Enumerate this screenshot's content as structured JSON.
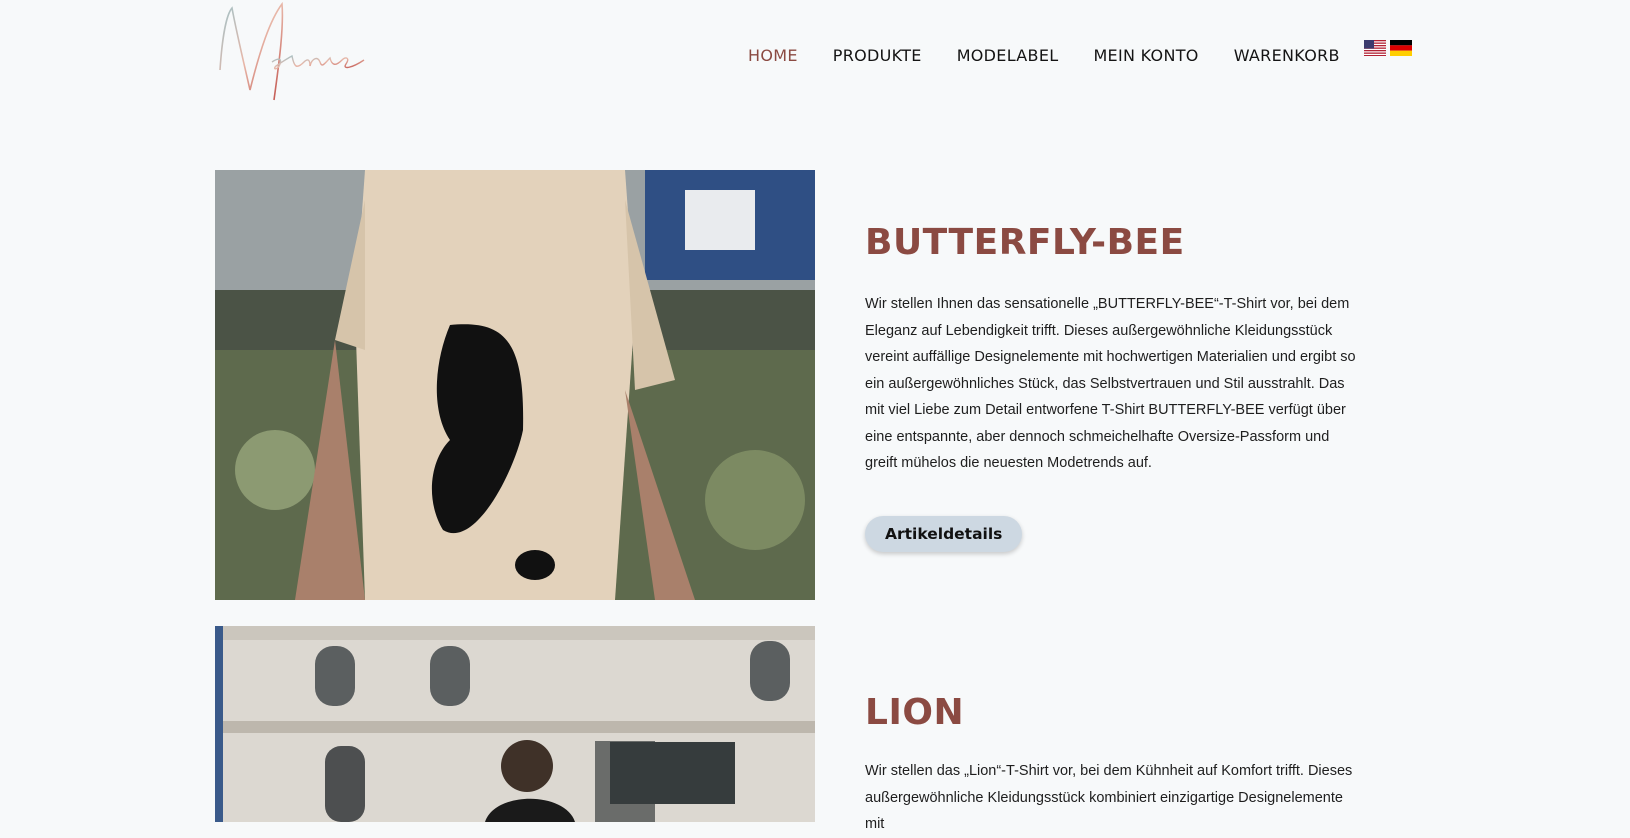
{
  "header": {
    "logo_text": "Nelane",
    "nav": [
      {
        "label": "HOME"
      },
      {
        "label": "PRODUKTE"
      },
      {
        "label": "MODELABEL"
      },
      {
        "label": "MEIN KONTO"
      },
      {
        "label": "WARENKORB"
      }
    ],
    "languages": [
      "flag-us-icon",
      "flag-de-icon"
    ]
  },
  "colors": {
    "accent": "#8b4a42",
    "button_bg": "#cdd8e2",
    "page_bg": "#f7f9fa"
  },
  "products": [
    {
      "title": "BUTTERFLY-BEE",
      "description": "Wir stellen Ihnen das sensationelle „BUTTERFLY-BEE“-T-Shirt vor, bei dem Eleganz auf Lebendigkeit trifft. Dieses außergewöhnliche Kleidungsstück vereint auffällige Designelemente mit hochwertigen Materialien und ergibt so ein außergewöhnliches Stück, das Selbstvertrauen und Stil ausstrahlt. Das mit viel Liebe zum Detail entworfene T-Shirt BUTTERFLY-BEE verfügt über eine entspannte, aber dennoch schmeichelhafte Oversize-Passform und greift mühelos die neuesten Modetrends auf.",
      "button": "Artikeldetails"
    },
    {
      "title": "LION",
      "description": "Wir stellen das „Lion“-T-Shirt vor, bei dem Kühnheit auf Komfort trifft. Dieses außergewöhnliche Kleidungsstück kombiniert einzigartige Designelemente mit"
    }
  ]
}
